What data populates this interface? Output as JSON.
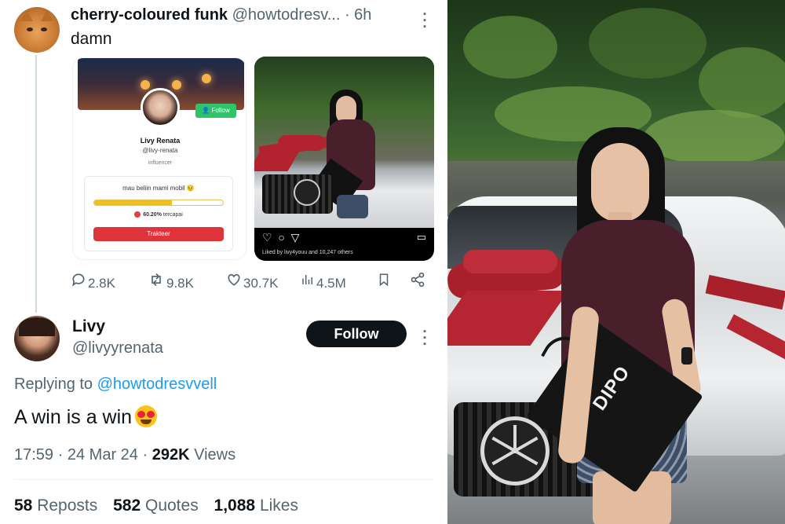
{
  "original_tweet": {
    "display_name": "cherry-coloured funk",
    "handle": "@howtodresv...",
    "separator": "·",
    "time": "6h",
    "text": "damn",
    "embedded_card": {
      "follow_label": "Follow",
      "name": "Livy Renata",
      "username": "@livy-renata",
      "role": "influencer",
      "goal_title": "mau beliin mami mobil 😣",
      "progress_fraction": 0.602,
      "progress_text": "60.20%",
      "progress_suffix": "tercapai",
      "button_label": "Trakteer"
    },
    "embedded_instagram": {
      "likes_text": "Liked by livy4youu and 10,247 others"
    },
    "actions": {
      "replies": "2.8K",
      "reposts": "9.8K",
      "likes": "30.7K",
      "views": "4.5M"
    }
  },
  "reply_tweet": {
    "display_name": "Livy",
    "handle": "@livyyrenata",
    "follow_label": "Follow",
    "replying_prefix": "Replying to",
    "replying_to": "@howtodresvvell",
    "text": "A win is a win",
    "time": "17:59",
    "dot": "·",
    "date": "24 Mar 24",
    "views_count": "292K",
    "views_label": "Views",
    "reposts_count": "58",
    "reposts_label": "Reposts",
    "quotes_count": "582",
    "quotes_label": "Quotes",
    "likes_count": "1,088",
    "likes_label": "Likes"
  },
  "photo": {
    "bag_brand": "DIPO"
  },
  "colors": {
    "link": "#1d9bf0",
    "secondary_text": "#536471",
    "follow_green": "#2fc46a",
    "progress_yellow": "#f1bd1f",
    "trakteer_red": "#e0343c",
    "shirt": "#4a1f2c",
    "bow": "#a8202c"
  },
  "icons": [
    "more-icon",
    "reply-icon",
    "repost-icon",
    "like-icon",
    "views-icon",
    "bookmark-icon",
    "share-icon",
    "heart-eyes-emoji"
  ]
}
